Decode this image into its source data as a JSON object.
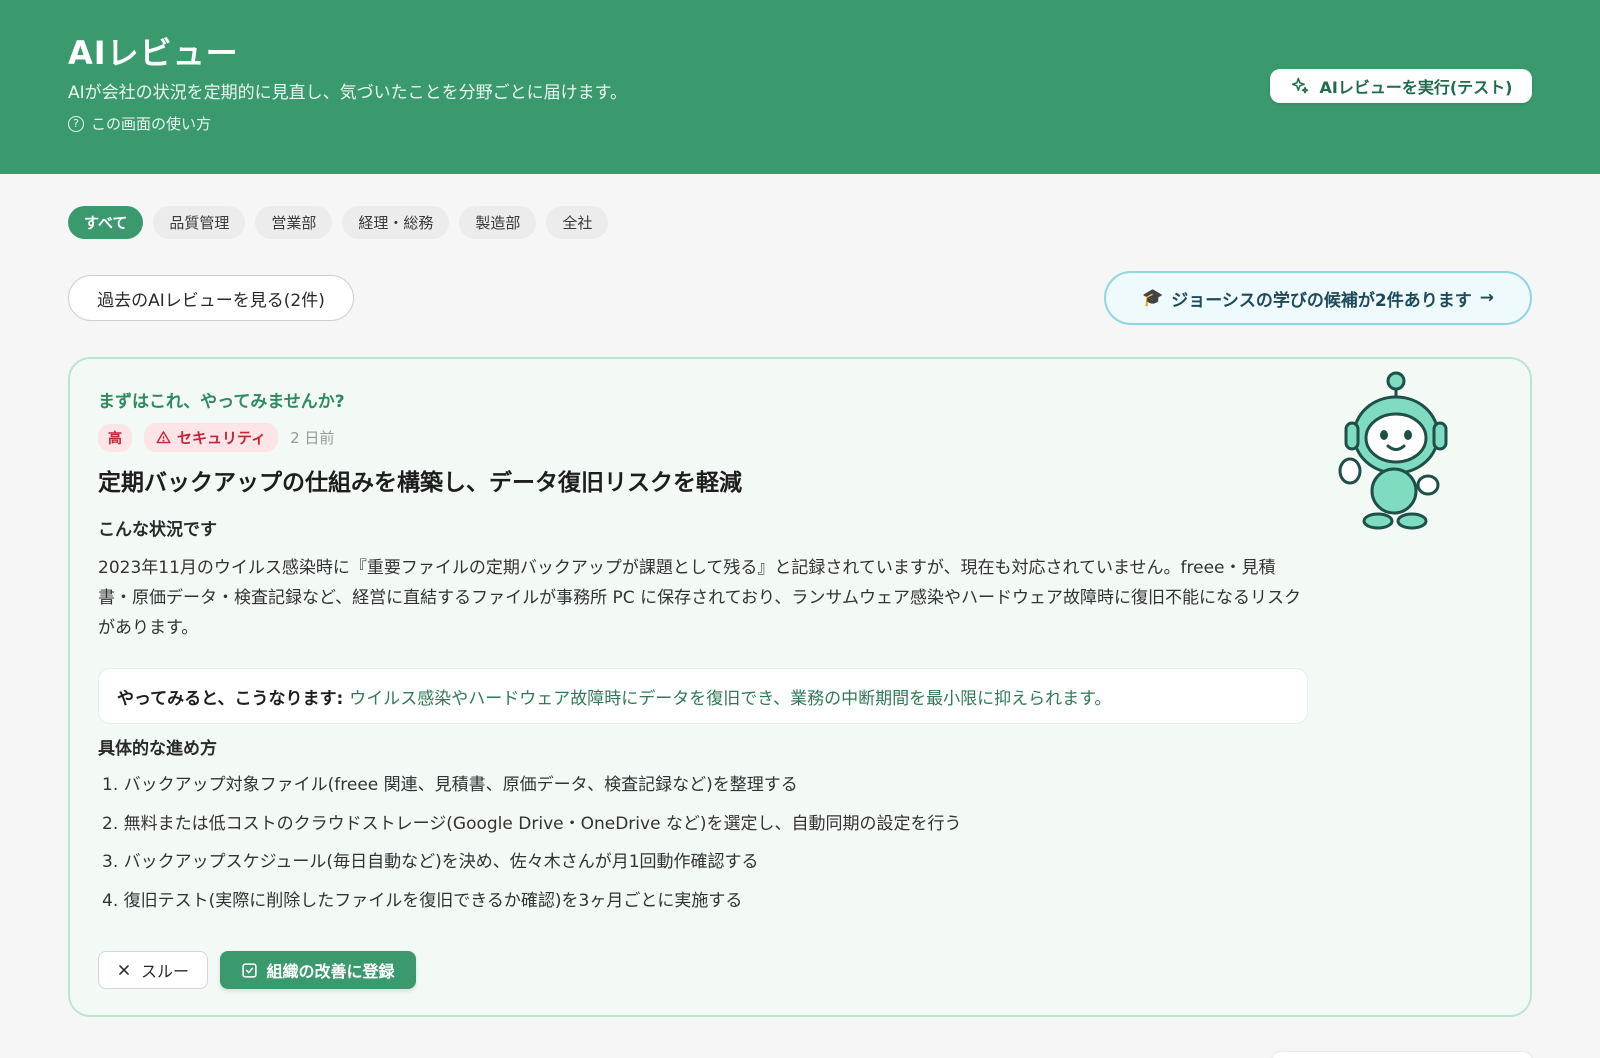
{
  "header": {
    "title": "AIレビュー",
    "subtitle": "AIが会社の状況を定期的に見直し、気づいたことを分野ごとに届けます。",
    "help_label": "この画面の使い方",
    "help_icon": "question-circle-icon",
    "run_button_label": "AIレビューを実行(テスト)",
    "run_button_icon": "sparkles-icon",
    "bg_color": "#3a9a6e"
  },
  "tabs": [
    {
      "label": "すべて",
      "active": true
    },
    {
      "label": "品質管理",
      "active": false
    },
    {
      "label": "営業部",
      "active": false
    },
    {
      "label": "経理・総務",
      "active": false
    },
    {
      "label": "製造部",
      "active": false
    },
    {
      "label": "全社",
      "active": false
    }
  ],
  "history_button_label": "過去のAIレビューを見る(2件)",
  "learning_button": {
    "icon": "graduation-cap-icon",
    "label": "ジョーシスの学びの候補が2件あります",
    "arrow": "→"
  },
  "card": {
    "eyebrow": "まずはこれ、やってみませんか?",
    "priority_badge": "高",
    "category_badge": "セキュリティ",
    "category_icon": "warning-triangle-icon",
    "date": "2 日前",
    "title": "定期バックアップの仕組みを構築し、データ復旧リスクを軽減",
    "situation_label": "こんな状況です",
    "situation_text": "2023年11月のウイルス感染時に『重要ファイルの定期バックアップが課題として残る』と記録されていますが、現在も対応されていません。freee・見積書・原価データ・検査記録など、経営に直結するファイルが事務所 PC に保存されており、ランサムウェア感染やハードウェア故障時に復旧不能になるリスクがあります。",
    "outcome_lead": "やってみると、こうなります:",
    "outcome_text": "ウイルス感染やハードウェア故障時にデータを復旧でき、業務の中断期間を最小限に抑えられます。",
    "steps_label": "具体的な進め方",
    "steps": [
      "1. バックアップ対象ファイル(freee 関連、見積書、原価データ、検査記録など)を整理する",
      "2. 無料または低コストのクラウドストレージ(Google Drive・OneDrive など)を選定し、自動同期の設定を行う",
      "3. バックアップスケジュール(毎日自動など)を決め、佐々木さんが月1回動作確認する",
      "4. 復旧テスト(実際に削除したファイルを復旧できるか確認)を3ヶ月ごとに実施する"
    ],
    "skip_label": "スルー",
    "skip_icon": "close-icon",
    "register_label": "組織の改善に登録",
    "register_icon": "checkbox-icon"
  }
}
